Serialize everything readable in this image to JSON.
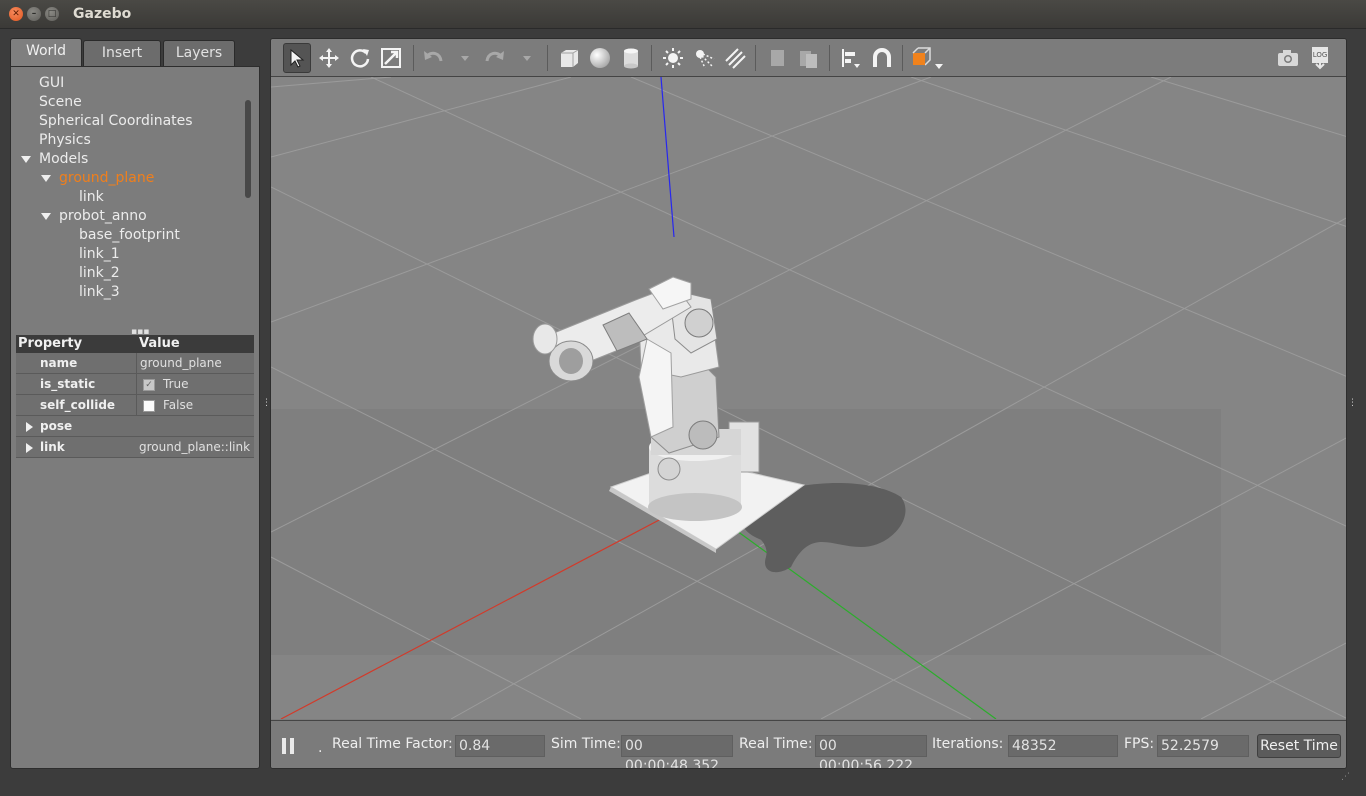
{
  "window": {
    "title": "Gazebo"
  },
  "colors": {
    "selected_text": "#f07f1c",
    "x_axis": "#d23a2a",
    "y_axis": "#2cad2c",
    "z_axis": "#2727ef",
    "insert_color": "#f0821c"
  },
  "left_panel": {
    "tabs": [
      {
        "label": "World"
      },
      {
        "label": "Insert"
      },
      {
        "label": "Layers"
      }
    ],
    "tree": [
      {
        "label": "GUI"
      },
      {
        "label": "Scene"
      },
      {
        "label": "Spherical Coordinates"
      },
      {
        "label": "Physics"
      },
      {
        "label": "Models"
      },
      {
        "label": "ground_plane"
      },
      {
        "label": "link"
      },
      {
        "label": "probot_anno"
      },
      {
        "label": "base_footprint"
      },
      {
        "label": "link_1"
      },
      {
        "label": "link_2"
      },
      {
        "label": "link_3"
      }
    ],
    "properties": {
      "header": {
        "property": "Property",
        "value": "Value"
      },
      "rows": [
        {
          "name": "name",
          "value": "ground_plane"
        },
        {
          "name": "is_static",
          "value": "True",
          "checked": true
        },
        {
          "name": "self_collide",
          "value": "False",
          "checked": false
        },
        {
          "name": "pose",
          "value": ""
        },
        {
          "name": "link",
          "value": "ground_plane::link"
        }
      ]
    }
  },
  "toolbar": {
    "tools": [
      {
        "icon": "select-arrow-icon"
      },
      {
        "icon": "translate-icon"
      },
      {
        "icon": "rotate-icon"
      },
      {
        "icon": "scale-icon"
      },
      {
        "icon": "undo-icon"
      },
      {
        "icon": "redo-icon"
      },
      {
        "icon": "box-icon"
      },
      {
        "icon": "sphere-icon"
      },
      {
        "icon": "cylinder-icon"
      },
      {
        "icon": "point-light-icon"
      },
      {
        "icon": "spot-light-icon"
      },
      {
        "icon": "directional-light-icon"
      },
      {
        "icon": "copy-icon"
      },
      {
        "icon": "paste-icon"
      },
      {
        "icon": "align-icon"
      },
      {
        "icon": "snap-icon"
      },
      {
        "icon": "view-angle-icon"
      },
      {
        "icon": "screenshot-icon"
      },
      {
        "icon": "log-icon"
      }
    ],
    "log_text": "LOG"
  },
  "status": {
    "real_time_factor_label": "Real Time Factor:",
    "real_time_factor": "0.84",
    "sim_time_label": "Sim Time:",
    "sim_time": "00 00:00:48.352",
    "real_time_label": "Real Time:",
    "real_time": "00 00:00:56.222",
    "iterations_label": "Iterations:",
    "iterations": "48352",
    "fps_label": "FPS:",
    "fps": "52.2579",
    "reset_label": "Reset Time",
    "step_indicator": "."
  }
}
